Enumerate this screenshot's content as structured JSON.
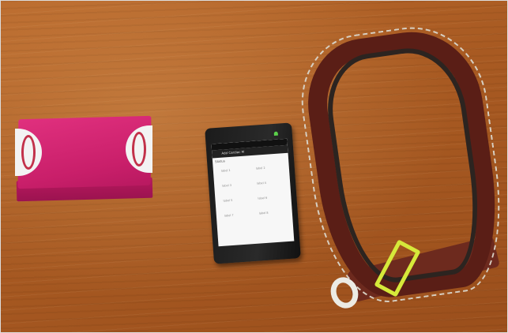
{
  "scene": {
    "description_colors": {
      "table": "#a85a22",
      "box": "#c91f6a",
      "belt": "#5a1e16",
      "buckle": "#d6e93a"
    }
  },
  "phone": {
    "app_title": "Add Cardiac M",
    "label": "Status",
    "grid": [
      "label 1",
      "label 2",
      "label 3",
      "label 4",
      "label 5",
      "label 6",
      "label 7",
      "label 8"
    ]
  }
}
